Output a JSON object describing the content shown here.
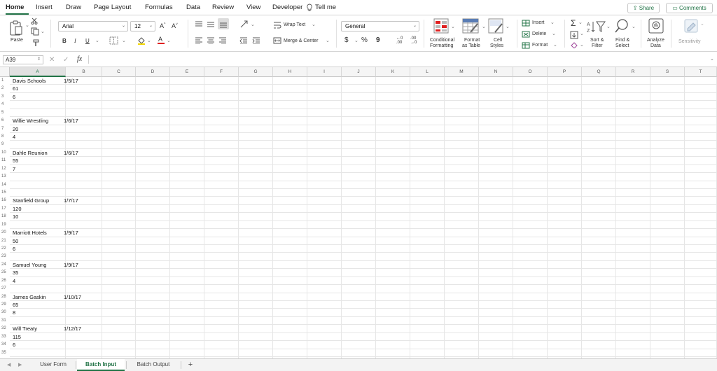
{
  "tabs": [
    "Home",
    "Insert",
    "Draw",
    "Page Layout",
    "Formulas",
    "Data",
    "Review",
    "View",
    "Developer"
  ],
  "tell_me": "Tell me",
  "share": "Share",
  "comments": "Comments",
  "ribbon": {
    "paste": "Paste",
    "font_name": "Arial",
    "font_size": "12",
    "bold": "B",
    "italic": "I",
    "underline": "U",
    "grow_font": "A^",
    "shrink_font": "A˅",
    "wrap_text": "Wrap Text",
    "merge_center": "Merge & Center",
    "number_format": "General",
    "currency": "$",
    "percent": "%",
    "comma": "9",
    "conditional": "Conditional",
    "formatting": "Formatting",
    "format_as": "Format",
    "as_table": "as Table",
    "cell": "Cell",
    "styles": "Styles",
    "insert": "Insert",
    "delete": "Delete",
    "format": "Format",
    "sort": "Sort &",
    "filter": "Filter",
    "find": "Find &",
    "select": "Select",
    "analyze": "Analyze",
    "data": "Data",
    "sensitivity": "Sensitivity"
  },
  "formula_bar": {
    "name_box": "A39",
    "fx": "fx",
    "value": ""
  },
  "columns": [
    "A",
    "B",
    "C",
    "D",
    "E",
    "F",
    "G",
    "H",
    "I",
    "J",
    "K",
    "L",
    "M",
    "N",
    "O",
    "P",
    "Q",
    "R",
    "S",
    "T"
  ],
  "rows": [
    "1",
    "2",
    "3",
    "4",
    "5",
    "6",
    "7",
    "8",
    "9",
    "10",
    "11",
    "12",
    "13",
    "14",
    "15",
    "16",
    "17",
    "18",
    "19",
    "20",
    "21",
    "22",
    "23",
    "24",
    "25",
    "26",
    "27",
    "28",
    "29",
    "30",
    "31",
    "32",
    "33",
    "34",
    "35"
  ],
  "cells": [
    {
      "r": 1,
      "a": "Davis Schools",
      "b": "1/5/17"
    },
    {
      "r": 2,
      "a": "61",
      "b": ""
    },
    {
      "r": 3,
      "a": "6",
      "b": ""
    },
    {
      "r": 6,
      "a": "Willie Wrestling",
      "b": "1/6/17"
    },
    {
      "r": 7,
      "a": "20",
      "b": ""
    },
    {
      "r": 8,
      "a": "4",
      "b": ""
    },
    {
      "r": 10,
      "a": "Dahle Reunion",
      "b": "1/6/17"
    },
    {
      "r": 11,
      "a": "55",
      "b": ""
    },
    {
      "r": 12,
      "a": "7",
      "b": ""
    },
    {
      "r": 16,
      "a": "Stanfield Group",
      "b": "1/7/17"
    },
    {
      "r": 17,
      "a": "120",
      "b": ""
    },
    {
      "r": 18,
      "a": "10",
      "b": ""
    },
    {
      "r": 20,
      "a": "Marriott Hotels",
      "b": "1/9/17"
    },
    {
      "r": 21,
      "a": "50",
      "b": ""
    },
    {
      "r": 22,
      "a": "6",
      "b": ""
    },
    {
      "r": 24,
      "a": "Samuel Young",
      "b": "1/9/17"
    },
    {
      "r": 25,
      "a": "35",
      "b": ""
    },
    {
      "r": 26,
      "a": "4",
      "b": ""
    },
    {
      "r": 28,
      "a": "James Gaskin",
      "b": "1/10/17"
    },
    {
      "r": 29,
      "a": "65",
      "b": ""
    },
    {
      "r": 30,
      "a": "8",
      "b": ""
    },
    {
      "r": 32,
      "a": "Will Treaty",
      "b": "1/12/17"
    },
    {
      "r": 33,
      "a": "115",
      "b": ""
    },
    {
      "r": 34,
      "a": "6",
      "b": ""
    }
  ],
  "sheets": [
    "User Form",
    "Batch Input",
    "Batch Output"
  ],
  "active_sheet": "Batch Input",
  "add_sheet": "+",
  "colors": {
    "accent": "#217346",
    "red": "#e02020",
    "gridline": "#e6e6e6"
  }
}
